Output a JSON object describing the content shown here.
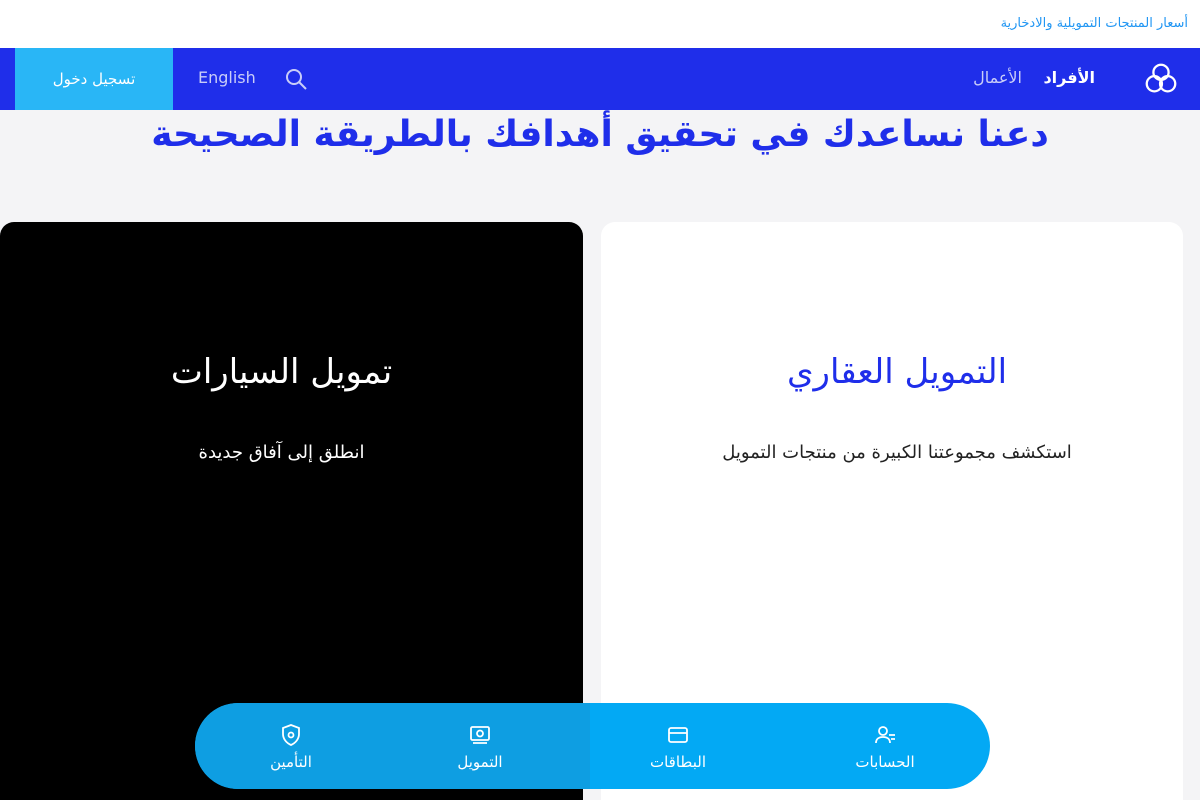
{
  "topbar": {
    "rates_link": "أسعار المنتجات التمويلية والادخارية"
  },
  "nav": {
    "individuals": "الأفراد",
    "business": "الأعمال",
    "language": "English",
    "login": "تسجيل دخول"
  },
  "hero": {
    "headline": "دعنا نساعدك في تحقيق أهدافك بالطريقة الصحيحة"
  },
  "cards": {
    "auto": {
      "title": "تمويل السيارات",
      "description": "انطلق إلى آفاق جديدة"
    },
    "mortgage": {
      "title": "التمويل العقاري",
      "description": "استكشف مجموعتنا الكبيرة من منتجات التمويل"
    }
  },
  "bottom_nav": {
    "accounts": "الحسابات",
    "cards": "البطاقات",
    "financing": "التمويل",
    "insurance": "التأمين"
  },
  "colors": {
    "brand_blue": "#1f2eea",
    "accent_cyan": "#29b6f6",
    "link_blue": "#2196f3"
  },
  "icons": [
    "bank-logo-icon",
    "search-icon",
    "accounts-icon",
    "cards-icon",
    "financing-icon",
    "insurance-icon"
  ]
}
